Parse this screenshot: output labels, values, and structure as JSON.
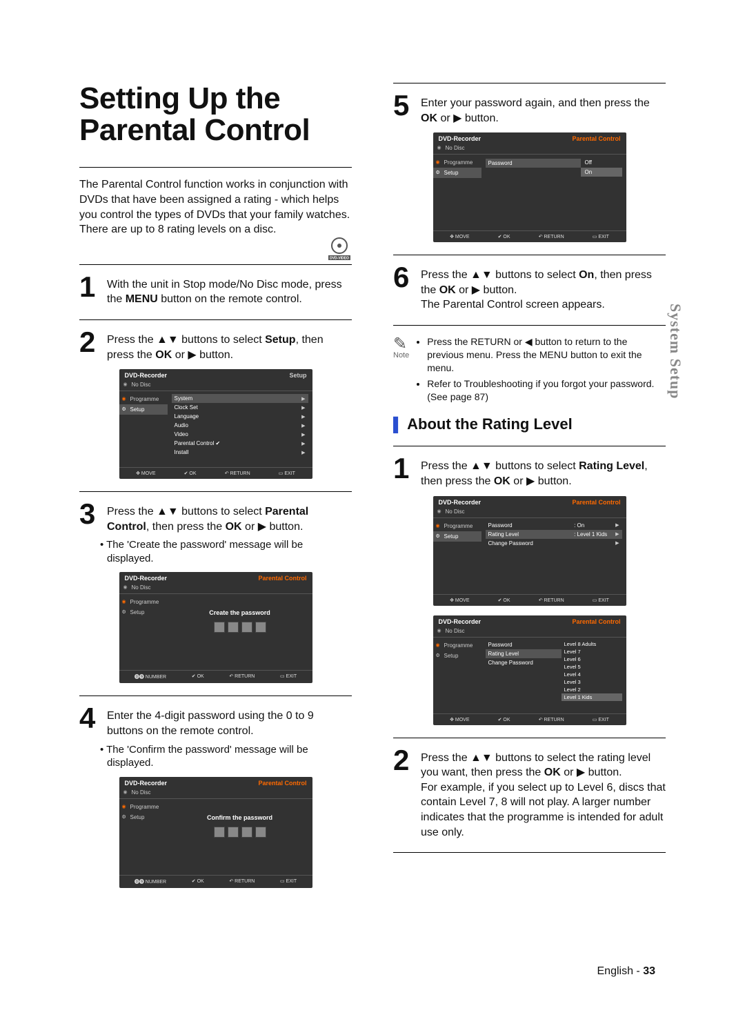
{
  "title": "Setting Up the Parental Control",
  "intro": "The Parental Control function works in conjunction with DVDs that have been assigned a rating - which helps you control the types of DVDs that your family watches. There are up to 8 rating levels on a disc.",
  "badge": "DVD-VIDEO",
  "steps": {
    "s1": {
      "num": "1",
      "text_a": "With the unit in Stop mode/No Disc mode, press the ",
      "bold": "MENU",
      "text_b": " button on the remote control."
    },
    "s2": {
      "num": "2",
      "text_a": "Press the ▲▼ buttons to select ",
      "bold": "Setup",
      "text_b": ", then press the ",
      "bold2": "OK",
      "text_c": " or ▶ button."
    },
    "s3": {
      "num": "3",
      "text_a": "Press the ▲▼ buttons to select ",
      "bold": "Parental Control",
      "text_b": ", then press the ",
      "bold2": "OK",
      "text_c": " or ▶ button."
    },
    "s3_bullet": "• The 'Create the password' message will be displayed.",
    "s4": {
      "num": "4",
      "text_a": "Enter the 4-digit password using the 0 to 9 buttons on the remote control."
    },
    "s4_bullet": "• The 'Confirm the password' message will be displayed.",
    "s5": {
      "num": "5",
      "text_a": "Enter your password again, and then press the ",
      "bold": "OK",
      "text_b": " or ▶ button."
    },
    "s6": {
      "num": "6",
      "text_a": "Press the ▲▼ buttons to select ",
      "bold": "On",
      "text_b": ", then press the ",
      "bold2": "OK",
      "text_c": " or ▶ button.",
      "extra": "The Parental Control screen appears."
    }
  },
  "note": {
    "label": "Note",
    "items": [
      "Press the RETURN or ◀ button to return to the previous menu. Press the MENU button to exit the menu.",
      "Refer to Troubleshooting if you forgot your password. (See page 87)"
    ]
  },
  "about": {
    "heading": "About the Rating Level",
    "s1": {
      "num": "1",
      "text_a": "Press the ▲▼ buttons to select ",
      "bold": "Rating Level",
      "text_b": ", then press the ",
      "bold2": "OK",
      "text_c": " or ▶ button."
    },
    "s2": {
      "num": "2",
      "text_a": "Press the ▲▼ buttons to select the rating level you want, then press the ",
      "bold": "OK",
      "text_b": " or ▶ button.",
      "extra": "For example, if you select up to Level 6, discs that contain Level 7, 8 will not play. A larger number indicates that the programme is intended for adult use only."
    }
  },
  "osd": {
    "recorder": "DVD-Recorder",
    "nodisc": "No Disc",
    "side_programme": "Programme",
    "side_setup": "Setup",
    "setup_title": "Setup",
    "pc_title": "Parental Control",
    "menu_items": [
      "System",
      "Clock Set",
      "Language",
      "Audio",
      "Video",
      "Parental Control ✔",
      "Install"
    ],
    "create_pw": "Create the password",
    "confirm_pw": "Confirm the password",
    "password": "Password",
    "off": "Off",
    "on": "On",
    "rating_level": "Rating Level",
    "level1kids": ": Level 1 Kids",
    "change_pw": "Change Password",
    "on_val": ": On",
    "levels": [
      "Level 8 Adults",
      "Level 7",
      "Level 6",
      "Level 5",
      "Level 4",
      "Level 3",
      "Level 2",
      "Level 1 Kids"
    ],
    "foot_move": "✥ MOVE",
    "foot_number": "⓿➒ NUMBER",
    "foot_ok": "✔ OK",
    "foot_return": "↶ RETURN",
    "foot_exit": "▭ EXIT"
  },
  "sidetab": "System Setup",
  "footer": {
    "lang": "English",
    "sep": " - ",
    "page": "33"
  }
}
